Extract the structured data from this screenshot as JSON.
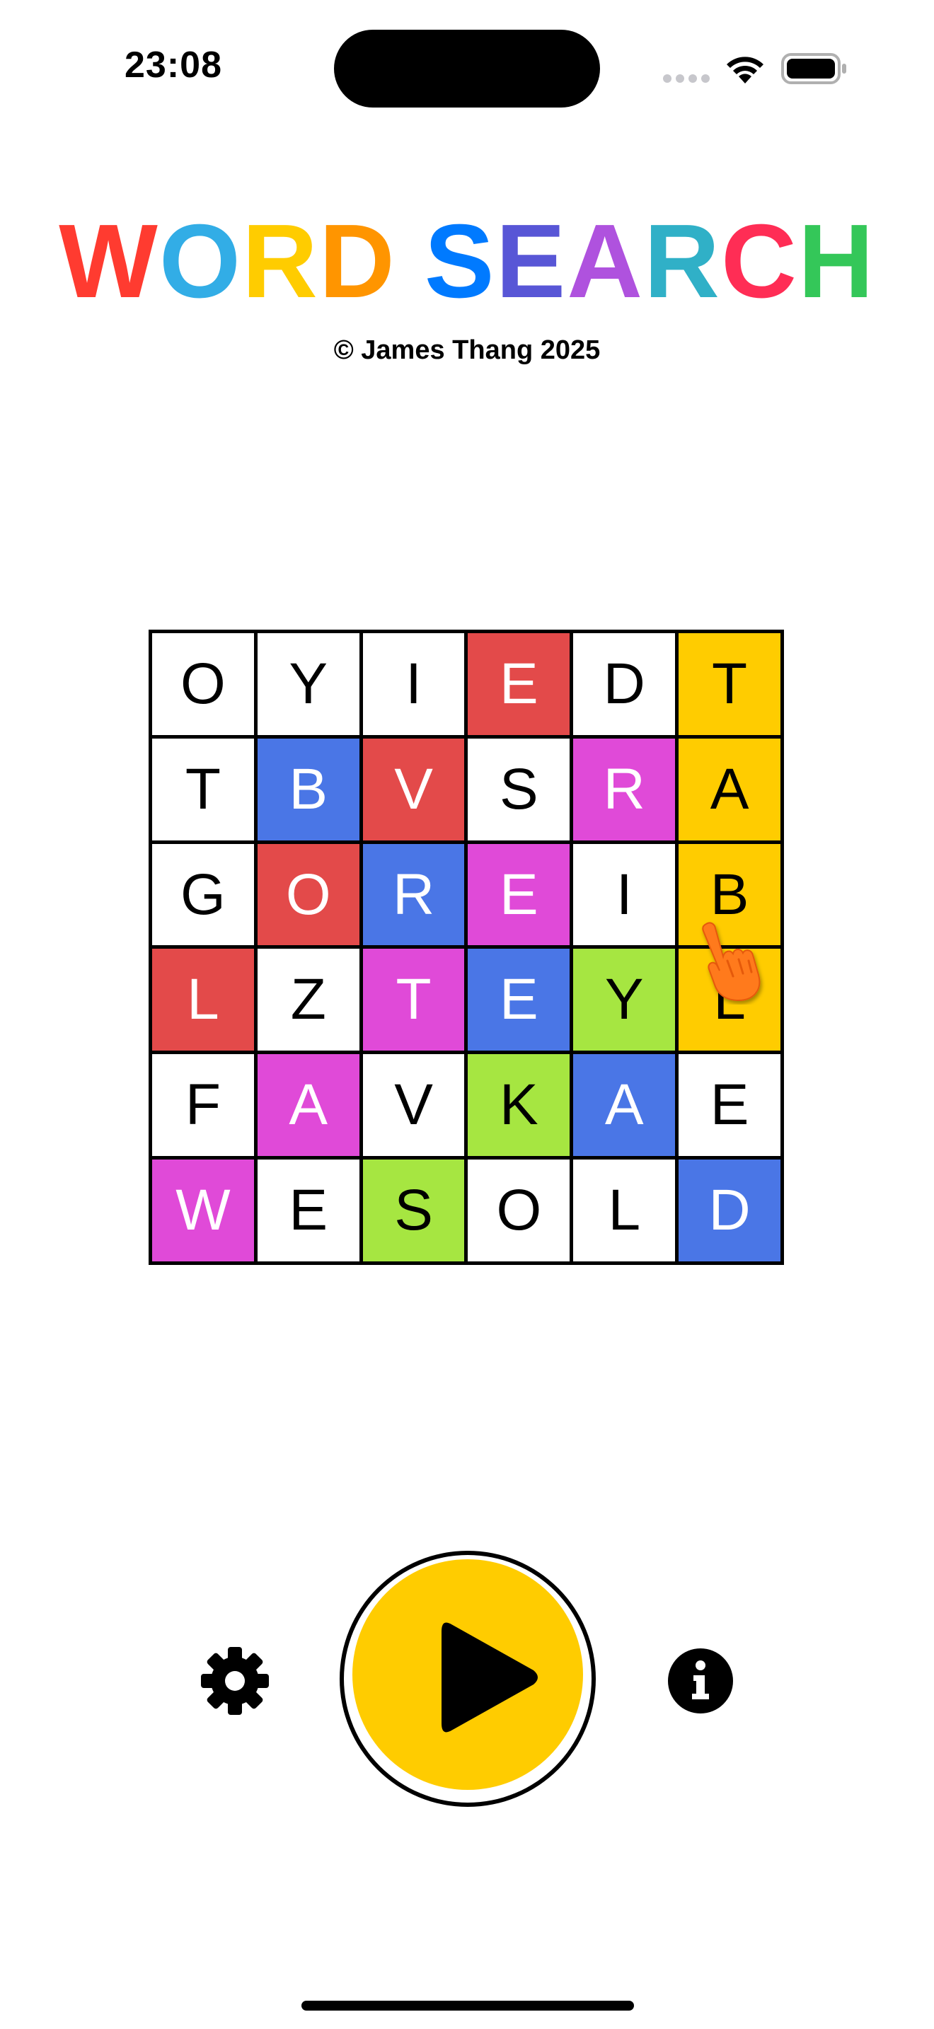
{
  "status_bar": {
    "time": "23:08"
  },
  "title": {
    "letters": [
      {
        "char": "W",
        "color": "#ff3b30"
      },
      {
        "char": "O",
        "color": "#32ade6"
      },
      {
        "char": "R",
        "color": "#ffcc00"
      },
      {
        "char": "D",
        "color": "#ff9500"
      },
      {
        "char": "S",
        "color": "#007aff"
      },
      {
        "char": "E",
        "color": "#5856d6"
      },
      {
        "char": "A",
        "color": "#af52de"
      },
      {
        "char": "R",
        "color": "#30b0c7"
      },
      {
        "char": "C",
        "color": "#ff2d55"
      },
      {
        "char": "H",
        "color": "#34c759"
      }
    ],
    "copyright": "© James Thang 2025"
  },
  "grid": {
    "rows": [
      [
        {
          "l": "O",
          "c": "white"
        },
        {
          "l": "Y",
          "c": "white"
        },
        {
          "l": "I",
          "c": "white"
        },
        {
          "l": "E",
          "c": "red"
        },
        {
          "l": "D",
          "c": "white"
        },
        {
          "l": "T",
          "c": "yellow"
        }
      ],
      [
        {
          "l": "T",
          "c": "white"
        },
        {
          "l": "B",
          "c": "blue"
        },
        {
          "l": "V",
          "c": "red"
        },
        {
          "l": "S",
          "c": "white"
        },
        {
          "l": "R",
          "c": "pink"
        },
        {
          "l": "A",
          "c": "yellow"
        }
      ],
      [
        {
          "l": "G",
          "c": "white"
        },
        {
          "l": "O",
          "c": "red"
        },
        {
          "l": "R",
          "c": "blue"
        },
        {
          "l": "E",
          "c": "pink"
        },
        {
          "l": "I",
          "c": "white"
        },
        {
          "l": "B",
          "c": "yellow"
        }
      ],
      [
        {
          "l": "L",
          "c": "red"
        },
        {
          "l": "Z",
          "c": "white"
        },
        {
          "l": "T",
          "c": "pink"
        },
        {
          "l": "E",
          "c": "blue"
        },
        {
          "l": "Y",
          "c": "green"
        },
        {
          "l": "L",
          "c": "yellow"
        }
      ],
      [
        {
          "l": "F",
          "c": "white"
        },
        {
          "l": "A",
          "c": "pink"
        },
        {
          "l": "V",
          "c": "white"
        },
        {
          "l": "K",
          "c": "green"
        },
        {
          "l": "A",
          "c": "blue"
        },
        {
          "l": "E",
          "c": "white"
        }
      ],
      [
        {
          "l": "W",
          "c": "pink"
        },
        {
          "l": "E",
          "c": "white"
        },
        {
          "l": "S",
          "c": "green"
        },
        {
          "l": "O",
          "c": "white"
        },
        {
          "l": "L",
          "c": "white"
        },
        {
          "l": "D",
          "c": "blue"
        }
      ]
    ]
  },
  "colors": {
    "red": "#e34a4a",
    "blue": "#4a76e6",
    "pink": "#e04ad8",
    "yellow": "#ffcc00",
    "green": "#a6e641",
    "play_button": "#ffcc00",
    "hand_icon": "#ff7a1a"
  },
  "controls": {
    "settings_icon": "gear-icon",
    "play_icon": "play-icon",
    "info_icon": "info-icon",
    "pointer_icon": "hand-pointer-icon"
  }
}
